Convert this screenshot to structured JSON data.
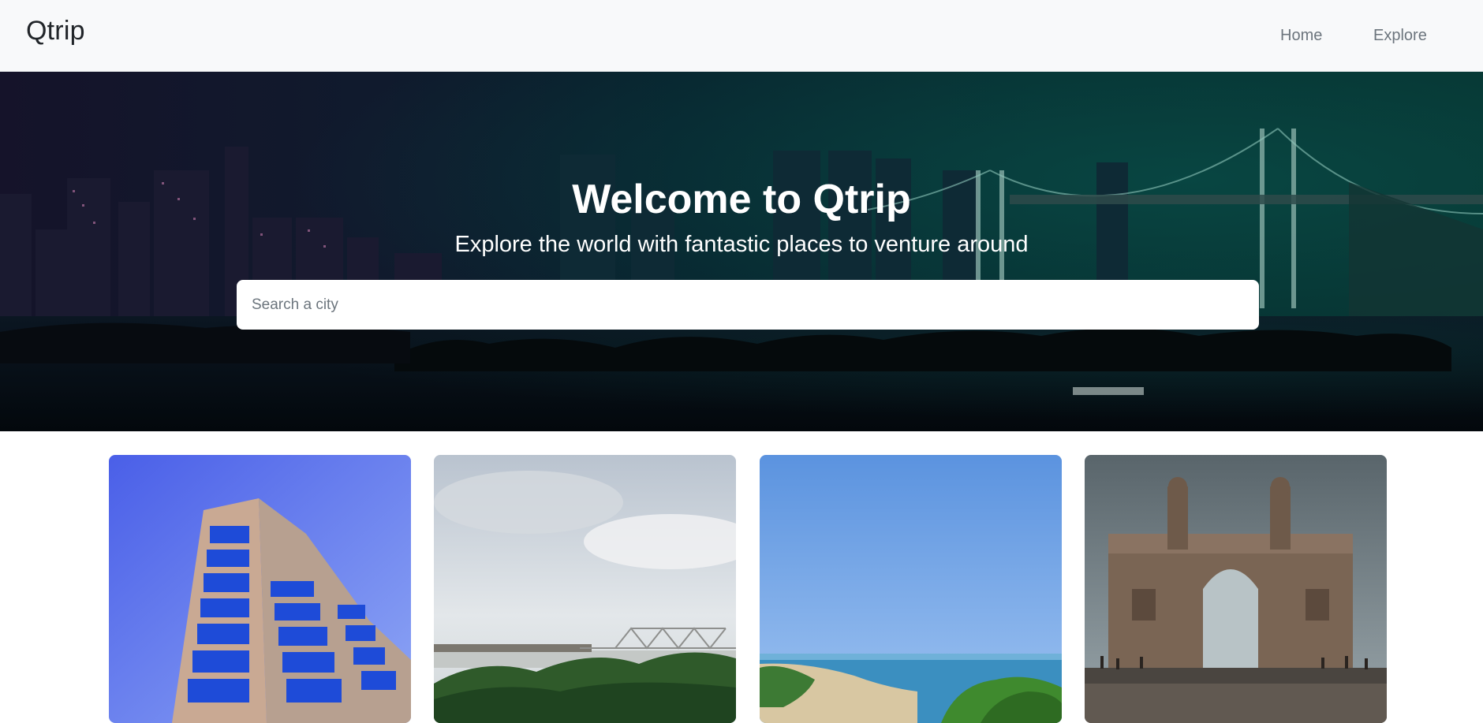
{
  "navbar": {
    "brand": "Qtrip",
    "links": [
      {
        "label": "Home"
      },
      {
        "label": "Explore"
      }
    ]
  },
  "hero": {
    "title": "Welcome to Qtrip",
    "subtitle": "Explore the world with fantastic places to venture around",
    "search_placeholder": "Search a city"
  },
  "cities": [
    {
      "photo": "glass office tower against blue sky"
    },
    {
      "photo": "river with steel bridge and trees under cloudy sky"
    },
    {
      "photo": "beach coastline with clear blue sky"
    },
    {
      "photo": "stone gateway monument with reflections"
    }
  ],
  "colors": {
    "navbar_bg": "#f8f9fa",
    "hero_teal": "#06302e",
    "hero_purple": "#15132a"
  }
}
